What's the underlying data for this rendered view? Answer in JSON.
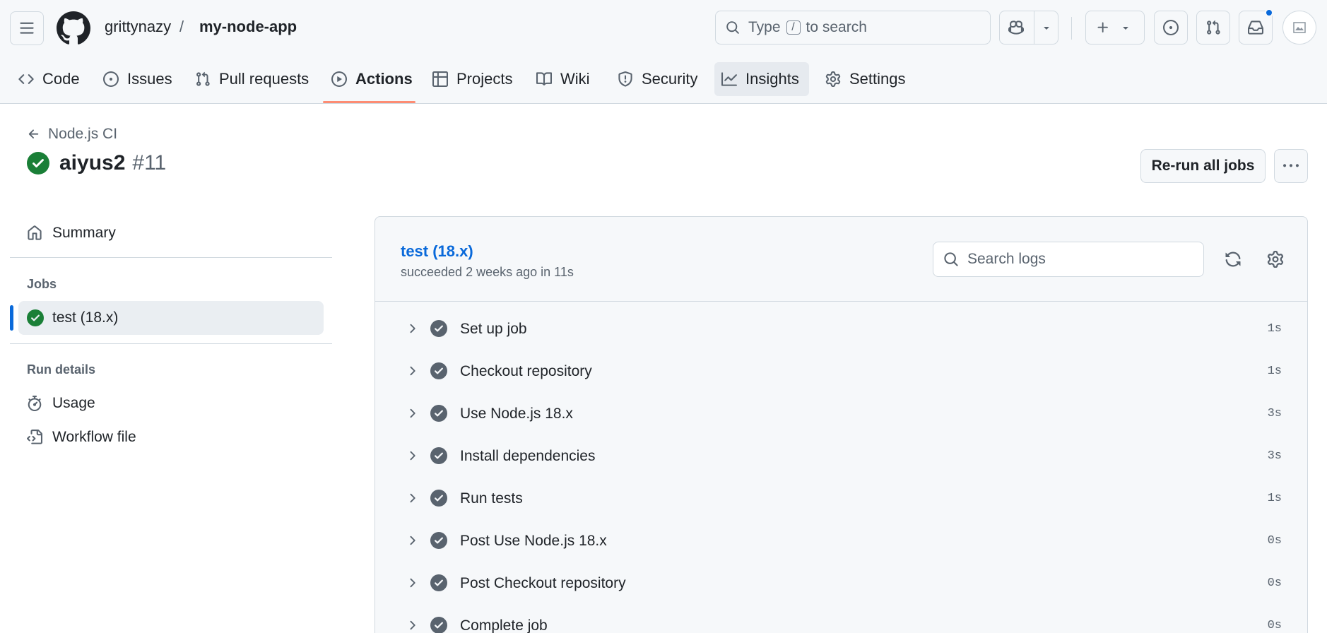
{
  "header": {
    "owner": "grittynazy",
    "separator": "/",
    "repo": "my-node-app",
    "search": {
      "prefix": "Type",
      "key": "/",
      "suffix": "to search"
    },
    "icons": [
      "menu-icon",
      "github-logo-icon",
      "search-icon",
      "copilot-icon",
      "triangle-down-icon",
      "plus-icon",
      "issue-opened-icon",
      "git-pull-request-icon",
      "inbox-icon"
    ],
    "notification_color": "#0969da"
  },
  "nav": {
    "tabs": [
      {
        "label": "Code",
        "icon": "code-icon"
      },
      {
        "label": "Issues",
        "icon": "issue-opened-icon"
      },
      {
        "label": "Pull requests",
        "icon": "git-pull-request-icon"
      },
      {
        "label": "Actions",
        "icon": "play-icon",
        "active": true
      },
      {
        "label": "Projects",
        "icon": "table-icon"
      },
      {
        "label": "Wiki",
        "icon": "book-icon"
      },
      {
        "label": "Security",
        "icon": "shield-icon"
      },
      {
        "label": "Insights",
        "icon": "graph-icon"
      },
      {
        "label": "Settings",
        "icon": "gear-icon"
      }
    ],
    "active_underline_color": "#fd8c73"
  },
  "run": {
    "back_label": "Node.js CI",
    "name": "aiyus2",
    "number": "#11",
    "rerun_label": "Re-run all jobs",
    "status_color": "#1a7f37"
  },
  "sidebar": {
    "summary_label": "Summary",
    "jobs_heading": "Jobs",
    "jobs": [
      {
        "label": "test (18.x)"
      }
    ],
    "details_heading": "Run details",
    "usage_label": "Usage",
    "workflow_label": "Workflow file"
  },
  "job": {
    "title": "test (18.x)",
    "subtitle": "succeeded 2 weeks ago in 11s",
    "search_placeholder": "Search logs",
    "steps": [
      {
        "label": "Set up job",
        "duration": "1s"
      },
      {
        "label": "Checkout repository",
        "duration": "1s"
      },
      {
        "label": "Use Node.js 18.x",
        "duration": "3s"
      },
      {
        "label": "Install dependencies",
        "duration": "3s"
      },
      {
        "label": "Run tests",
        "duration": "1s"
      },
      {
        "label": "Post Use Node.js 18.x",
        "duration": "0s"
      },
      {
        "label": "Post Checkout repository",
        "duration": "0s"
      },
      {
        "label": "Complete job",
        "duration": "0s"
      }
    ]
  }
}
